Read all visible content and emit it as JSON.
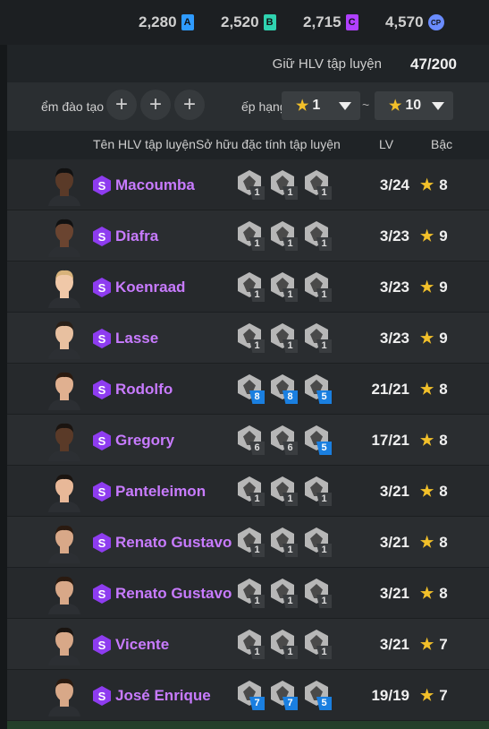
{
  "currencies": [
    {
      "value": "2,280",
      "letter": "A",
      "color": "#2f9bff",
      "shape": "card"
    },
    {
      "value": "2,520",
      "letter": "B",
      "color": "#2fd3b0",
      "shape": "card"
    },
    {
      "value": "2,715",
      "letter": "C",
      "color": "#b040ff",
      "shape": "card"
    },
    {
      "value": "4,570",
      "letter": "CP",
      "color": "#6a8cff",
      "shape": "round"
    }
  ],
  "held": {
    "label": "Giữ HLV tập luyện",
    "value": "47/200"
  },
  "filter": {
    "training_label": "ểm đào tạo",
    "plus": [
      "+",
      "+",
      "+"
    ],
    "rank_label": "ếp hạng",
    "rank_from": "1",
    "tilde": "~",
    "rank_to": "10",
    "star": "★"
  },
  "headers": {
    "name": "Tên HLV tập luyện",
    "traits": "Sở hữu đặc tính tập luyện",
    "lv": "LV",
    "grade": "Bậc"
  },
  "rows": [
    {
      "name": "Macoumba",
      "lv": "3/24",
      "grade": "8",
      "skin": "#5a3a28",
      "hair": "#111",
      "traits": [
        {
          "n": "1",
          "blue": false
        },
        {
          "n": "1",
          "blue": false
        },
        {
          "n": "1",
          "blue": false
        }
      ]
    },
    {
      "name": "Diafra",
      "lv": "3/23",
      "grade": "9",
      "skin": "#6a4430",
      "hair": "#111",
      "traits": [
        {
          "n": "1",
          "blue": false
        },
        {
          "n": "1",
          "blue": false
        },
        {
          "n": "1",
          "blue": false
        }
      ]
    },
    {
      "name": "Koenraad",
      "lv": "3/23",
      "grade": "9",
      "skin": "#f0c8a8",
      "hair": "#d8b27a",
      "traits": [
        {
          "n": "1",
          "blue": false
        },
        {
          "n": "1",
          "blue": false
        },
        {
          "n": "1",
          "blue": false
        }
      ]
    },
    {
      "name": "Lasse",
      "lv": "3/23",
      "grade": "9",
      "skin": "#e8c0a0",
      "hair": "#2a2018",
      "traits": [
        {
          "n": "1",
          "blue": false
        },
        {
          "n": "1",
          "blue": false
        },
        {
          "n": "1",
          "blue": false
        }
      ]
    },
    {
      "name": "Rodolfo",
      "lv": "21/21",
      "grade": "8",
      "skin": "#e0b090",
      "hair": "#2a1a10",
      "traits": [
        {
          "n": "8",
          "blue": true
        },
        {
          "n": "8",
          "blue": true
        },
        {
          "n": "5",
          "blue": true
        }
      ]
    },
    {
      "name": "Gregory",
      "lv": "17/21",
      "grade": "8",
      "skin": "#5a3a28",
      "hair": "#1a1410",
      "traits": [
        {
          "n": "6",
          "blue": false
        },
        {
          "n": "6",
          "blue": false
        },
        {
          "n": "5",
          "blue": true
        }
      ]
    },
    {
      "name": "Panteleimon",
      "lv": "3/21",
      "grade": "8",
      "skin": "#e8b898",
      "hair": "#1a1410",
      "traits": [
        {
          "n": "1",
          "blue": false
        },
        {
          "n": "1",
          "blue": false
        },
        {
          "n": "1",
          "blue": false
        }
      ]
    },
    {
      "name": "Renato Gustavo",
      "lv": "3/21",
      "grade": "8",
      "skin": "#d8a888",
      "hair": "#2a1a10",
      "traits": [
        {
          "n": "1",
          "blue": false
        },
        {
          "n": "1",
          "blue": false
        },
        {
          "n": "1",
          "blue": false
        }
      ]
    },
    {
      "name": "Renato Gustavo",
      "lv": "3/21",
      "grade": "8",
      "skin": "#d8a888",
      "hair": "#2a1a10",
      "traits": [
        {
          "n": "1",
          "blue": false
        },
        {
          "n": "1",
          "blue": false
        },
        {
          "n": "1",
          "blue": false
        }
      ]
    },
    {
      "name": "Vicente",
      "lv": "3/21",
      "grade": "7",
      "skin": "#d8a888",
      "hair": "#1a1410",
      "traits": [
        {
          "n": "1",
          "blue": false
        },
        {
          "n": "1",
          "blue": false
        },
        {
          "n": "1",
          "blue": false
        }
      ]
    },
    {
      "name": "José Enrique",
      "lv": "19/19",
      "grade": "7",
      "skin": "#d8a888",
      "hair": "#2a1a10",
      "traits": [
        {
          "n": "7",
          "blue": true
        },
        {
          "n": "7",
          "blue": true
        },
        {
          "n": "5",
          "blue": true
        }
      ]
    }
  ]
}
